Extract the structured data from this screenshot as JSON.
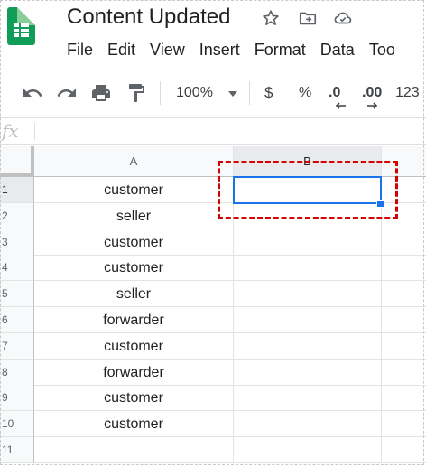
{
  "document": {
    "title": "Content Updated"
  },
  "menu": {
    "items": [
      "File",
      "Edit",
      "View",
      "Insert",
      "Format",
      "Data",
      "Too"
    ]
  },
  "toolbar": {
    "zoom": "100%",
    "currency": "$",
    "percent": "%",
    "decrease_decimals": ".0",
    "increase_decimals": ".00",
    "more_formats": "123"
  },
  "formula_bar": {
    "fx_label": "fx",
    "value": ""
  },
  "sheet": {
    "columns": [
      "A",
      "B"
    ],
    "rows": [
      {
        "num": "1",
        "a": "customer",
        "b": ""
      },
      {
        "num": "2",
        "a": "seller",
        "b": ""
      },
      {
        "num": "3",
        "a": "customer",
        "b": ""
      },
      {
        "num": "4",
        "a": "customer",
        "b": ""
      },
      {
        "num": "5",
        "a": "seller",
        "b": ""
      },
      {
        "num": "6",
        "a": "forwarder",
        "b": ""
      },
      {
        "num": "7",
        "a": "customer",
        "b": ""
      },
      {
        "num": "8",
        "a": "forwarder",
        "b": ""
      },
      {
        "num": "9",
        "a": "customer",
        "b": ""
      },
      {
        "num": "10",
        "a": "customer",
        "b": ""
      },
      {
        "num": "11",
        "a": "",
        "b": ""
      }
    ],
    "selected_cell": "B1"
  },
  "colors": {
    "brand_green": "#0f9d58",
    "selection_blue": "#1a73e8",
    "annotation_red": "#d50000"
  },
  "icons": [
    "sheets-logo",
    "star-icon",
    "move-to-folder-icon",
    "cloud-saved-icon",
    "undo-icon",
    "redo-icon",
    "print-icon",
    "paint-format-icon",
    "dropdown-arrow-icon"
  ]
}
